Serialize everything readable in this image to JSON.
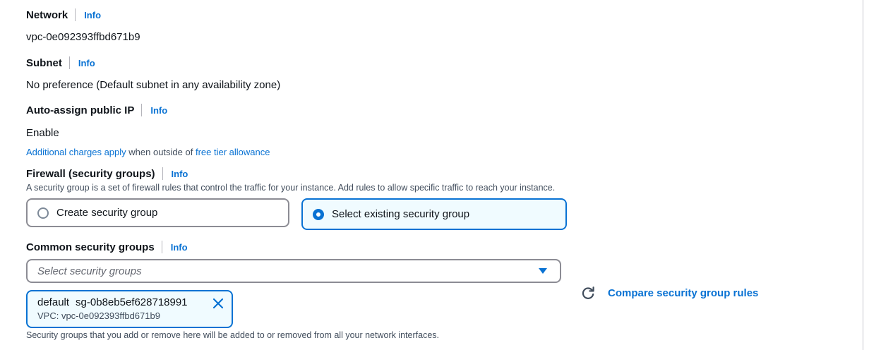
{
  "network": {
    "label": "Network",
    "info": "Info",
    "value": "vpc-0e092393ffbd671b9"
  },
  "subnet": {
    "label": "Subnet",
    "info": "Info",
    "value": "No preference (Default subnet in any availability zone)"
  },
  "auto_assign_ip": {
    "label": "Auto-assign public IP",
    "info": "Info",
    "value": "Enable",
    "note_link1": "Additional charges apply",
    "note_middle": " when outside of ",
    "note_link2": "free tier allowance"
  },
  "firewall": {
    "label": "Firewall (security groups)",
    "info": "Info",
    "description": "A security group is a set of firewall rules that control the traffic for your instance. Add rules to allow specific traffic to reach your instance.",
    "options": [
      {
        "label": "Create security group",
        "selected": false
      },
      {
        "label": "Select existing security group",
        "selected": true
      }
    ]
  },
  "common_sg": {
    "label": "Common security groups",
    "info": "Info",
    "placeholder": "Select security groups",
    "token": {
      "name": "default",
      "id": "sg-0b8eb5ef628718991",
      "vpc": "VPC: vpc-0e092393ffbd671b9"
    },
    "compare_label": "Compare security group rules",
    "footnote": "Security groups that you add or remove here will be added to or removed from all your network interfaces."
  },
  "colors": {
    "accent": "#0972d3",
    "text": "#0f141a",
    "secondary_text": "#414d5c",
    "border": "#8c8c94"
  },
  "icons": {
    "radio_off": "radio-unchecked-icon",
    "radio_on": "radio-checked-icon",
    "caret": "caret-down-icon",
    "remove": "close-icon",
    "refresh": "refresh-icon"
  }
}
